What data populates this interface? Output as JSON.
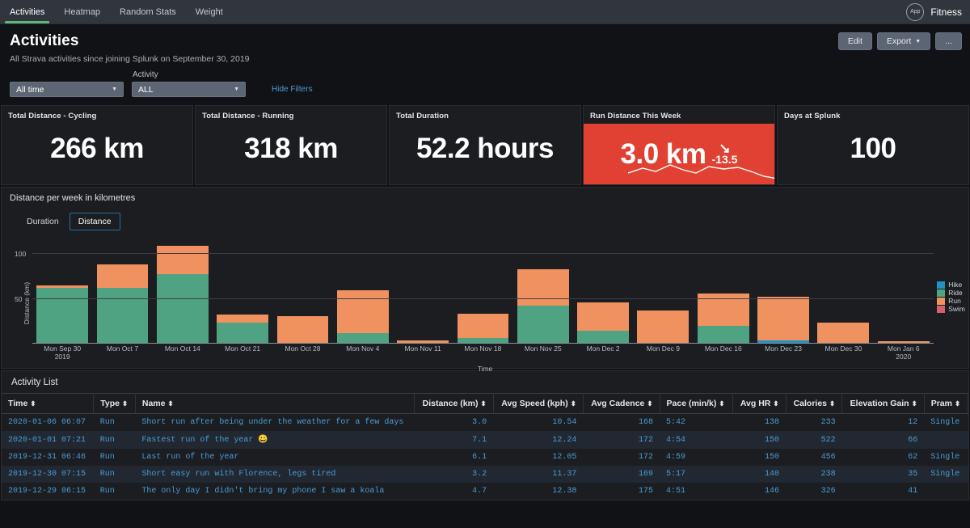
{
  "nav": {
    "tabs": [
      {
        "label": "Activities",
        "active": true
      },
      {
        "label": "Heatmap",
        "active": false
      },
      {
        "label": "Random Stats",
        "active": false
      },
      {
        "label": "Weight",
        "active": false
      }
    ],
    "app_badge": "App",
    "app_name": "Fitness"
  },
  "header": {
    "title": "Activities",
    "subtitle": "All Strava activities since joining Splunk on September 30, 2019",
    "buttons": [
      {
        "label": "Edit",
        "caret": false
      },
      {
        "label": "Export",
        "caret": true
      },
      {
        "label": "...",
        "caret": false
      }
    ]
  },
  "filters": {
    "time_value": "All time",
    "activity_label": "Activity",
    "activity_value": "ALL",
    "hide_filters": "Hide Filters"
  },
  "kpis": [
    {
      "title": "Total Distance - Cycling",
      "value": "266 km",
      "alert": false
    },
    {
      "title": "Total Distance - Running",
      "value": "318 km",
      "alert": false
    },
    {
      "title": "Total Duration",
      "value": "52.2 hours",
      "alert": false
    },
    {
      "title": "Run Distance This Week",
      "value": "3.0 km",
      "alert": true,
      "delta": "-13.5",
      "delta_arrow": "↘"
    },
    {
      "title": "Days at Splunk",
      "value": "100",
      "alert": false
    }
  ],
  "chart_panel": {
    "title": "Distance per week in kilometres",
    "toggles": [
      {
        "label": "Duration",
        "active": false
      },
      {
        "label": "Distance",
        "active": true
      }
    ]
  },
  "chart_data": {
    "type": "bar",
    "stacked": true,
    "title": "Distance per week in kilometres",
    "xlabel": "Time",
    "ylabel": "Distance (km)",
    "ylim": [
      0,
      110
    ],
    "yticks": [
      50,
      100
    ],
    "grid": true,
    "legend_position": "right",
    "categories": [
      "Mon Sep 30\n2019",
      "Mon Oct 7",
      "Mon Oct 14",
      "Mon Oct 21",
      "Mon Oct 28",
      "Mon Nov 4",
      "Mon Nov 11",
      "Mon Nov 18",
      "Mon Nov 25",
      "Mon Dec 2",
      "Mon Dec 9",
      "Mon Dec 16",
      "Mon Dec 23",
      "Mon Dec 30",
      "Mon Jan 6\n2020"
    ],
    "series": [
      {
        "name": "Hike",
        "color": "#1e93c6",
        "values": [
          0,
          0,
          0,
          0,
          0,
          0,
          0,
          0,
          0,
          0,
          0,
          0,
          3,
          0,
          0
        ]
      },
      {
        "name": "Ride",
        "color": "#4fa383",
        "values": [
          52,
          52,
          65,
          20,
          0,
          10,
          0,
          5,
          36,
          12,
          0,
          17,
          0,
          0,
          0
        ]
      },
      {
        "name": "Run",
        "color": "#ef925f",
        "values": [
          3,
          22,
          27,
          7,
          26,
          40,
          3,
          23,
          34,
          27,
          31,
          30,
          41,
          20,
          2
        ]
      },
      {
        "name": "Swim",
        "color": "#d4606d",
        "values": [
          0,
          0,
          0,
          0,
          0,
          0,
          0,
          0,
          0,
          0,
          0,
          0,
          0,
          0,
          0
        ]
      }
    ]
  },
  "table": {
    "title": "Activity List",
    "columns": [
      {
        "label": "Time",
        "align": "left"
      },
      {
        "label": "Type",
        "align": "left"
      },
      {
        "label": "Name",
        "align": "left"
      },
      {
        "label": "Distance (km)",
        "align": "right"
      },
      {
        "label": "Avg Speed (kph)",
        "align": "right"
      },
      {
        "label": "Avg Cadence",
        "align": "right"
      },
      {
        "label": "Pace (min/k)",
        "align": "left"
      },
      {
        "label": "Avg HR",
        "align": "right"
      },
      {
        "label": "Calories",
        "align": "right"
      },
      {
        "label": "Elevation Gain",
        "align": "right"
      },
      {
        "label": "Pram",
        "align": "left"
      }
    ],
    "sort_glyph": "⬍",
    "rows": [
      [
        "2020-01-06 06:07",
        "Run",
        "Short run after being under the weather for a few days",
        "3.0",
        "10.54",
        "168",
        "5:42",
        "138",
        "233",
        "12",
        "Single"
      ],
      [
        "2020-01-01 07:21",
        "Run",
        "Fastest run of the year 😀",
        "7.1",
        "12.24",
        "172",
        "4:54",
        "150",
        "522",
        "66",
        ""
      ],
      [
        "2019-12-31 06:46",
        "Run",
        "Last run of the year",
        "6.1",
        "12.05",
        "172",
        "4:59",
        "150",
        "456",
        "62",
        "Single"
      ],
      [
        "2019-12-30 07:15",
        "Run",
        "Short easy run with Florence, legs tired",
        "3.2",
        "11.37",
        "169",
        "5:17",
        "140",
        "238",
        "35",
        "Single"
      ],
      [
        "2019-12-29 06:15",
        "Run",
        "The only day I didn't bring my phone I saw a koala",
        "4.7",
        "12.38",
        "175",
        "4:51",
        "146",
        "326",
        "41",
        ""
      ]
    ]
  },
  "colors": {
    "accent_green": "#5fb87a",
    "alert_red": "#e04132",
    "link_blue": "#4a9cd6"
  }
}
